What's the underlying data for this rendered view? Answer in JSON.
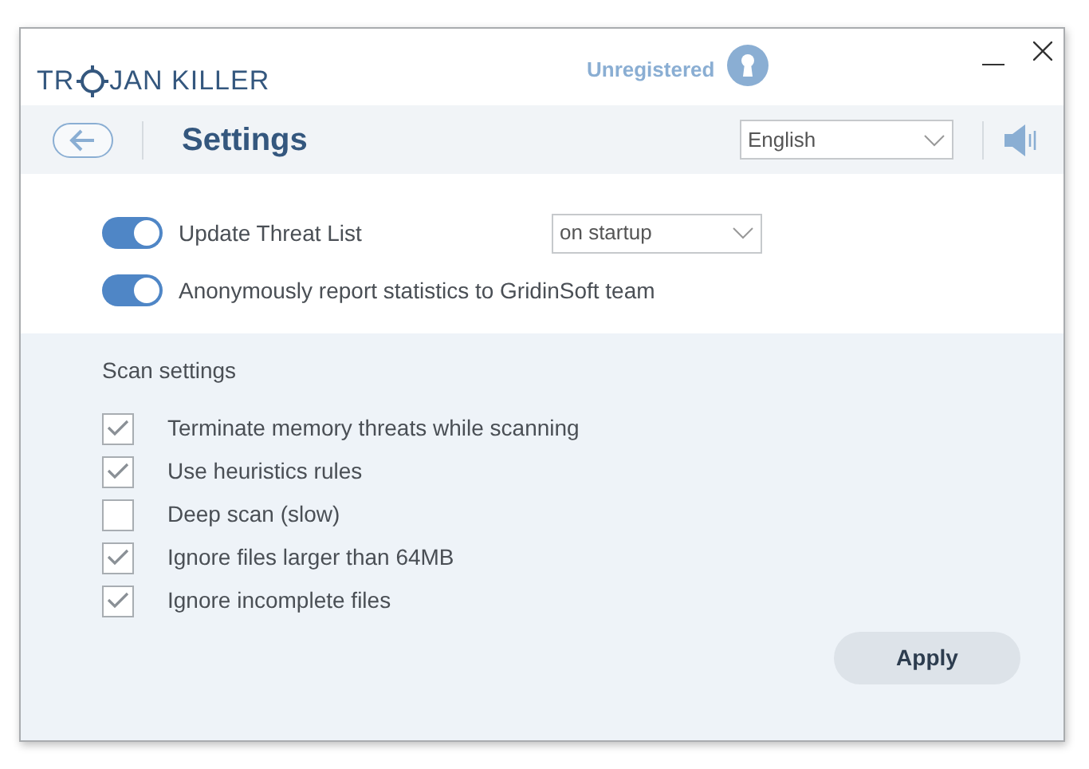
{
  "window": {
    "logo_start": "TR",
    "logo_end": "JAN KILLER",
    "account_status": "Unregistered"
  },
  "toolbar": {
    "title": "Settings",
    "language": {
      "value": "English"
    },
    "sound_on": true
  },
  "general": [
    {
      "label": "Update Threat List",
      "on": true,
      "dropdown": "on startup"
    },
    {
      "label": "Anonymously report statistics to GridinSoft team",
      "on": true
    }
  ],
  "scan_settings": {
    "heading": "Scan settings",
    "options": [
      {
        "label": "Terminate memory threats while scanning",
        "checked": true
      },
      {
        "label": "Use heuristics rules",
        "checked": true
      },
      {
        "label": "Deep scan (slow)",
        "checked": false
      },
      {
        "label": "Ignore files larger than 64MB",
        "checked": true
      },
      {
        "label": "Ignore incomplete files",
        "checked": true
      }
    ]
  },
  "buttons": [
    {
      "label": "Apply"
    }
  ]
}
